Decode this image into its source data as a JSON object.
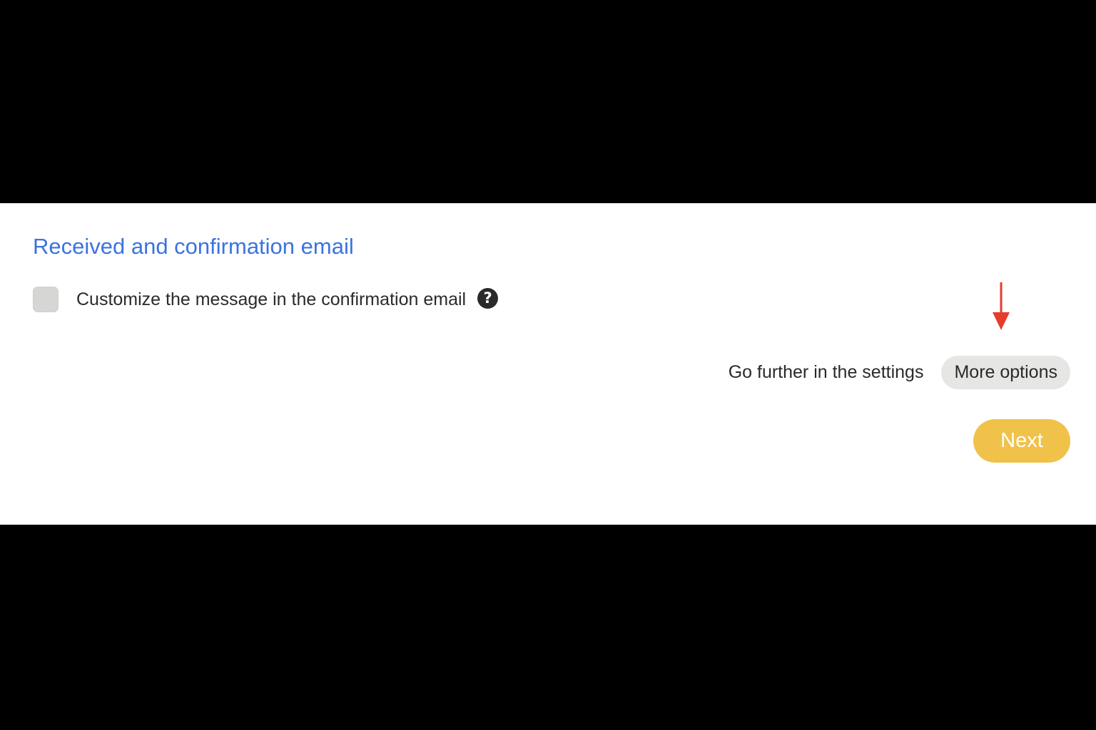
{
  "section": {
    "title": "Received and confirmation email"
  },
  "option": {
    "checked": false,
    "label": "Customize the message in the confirmation email",
    "help_glyph": "?"
  },
  "settings": {
    "text": "Go further in the settings",
    "more_options_label": "More options"
  },
  "next_label": "Next",
  "icons": {
    "checkbox": "checkbox-unchecked",
    "help": "question-circle-icon",
    "annotation": "red-down-arrow-icon"
  },
  "colors": {
    "title": "#3b73e0",
    "next_button": "#f0c24a",
    "more_options_button": "#e6e6e4",
    "arrow": "#e53d2c",
    "letterbox": "#000000"
  }
}
